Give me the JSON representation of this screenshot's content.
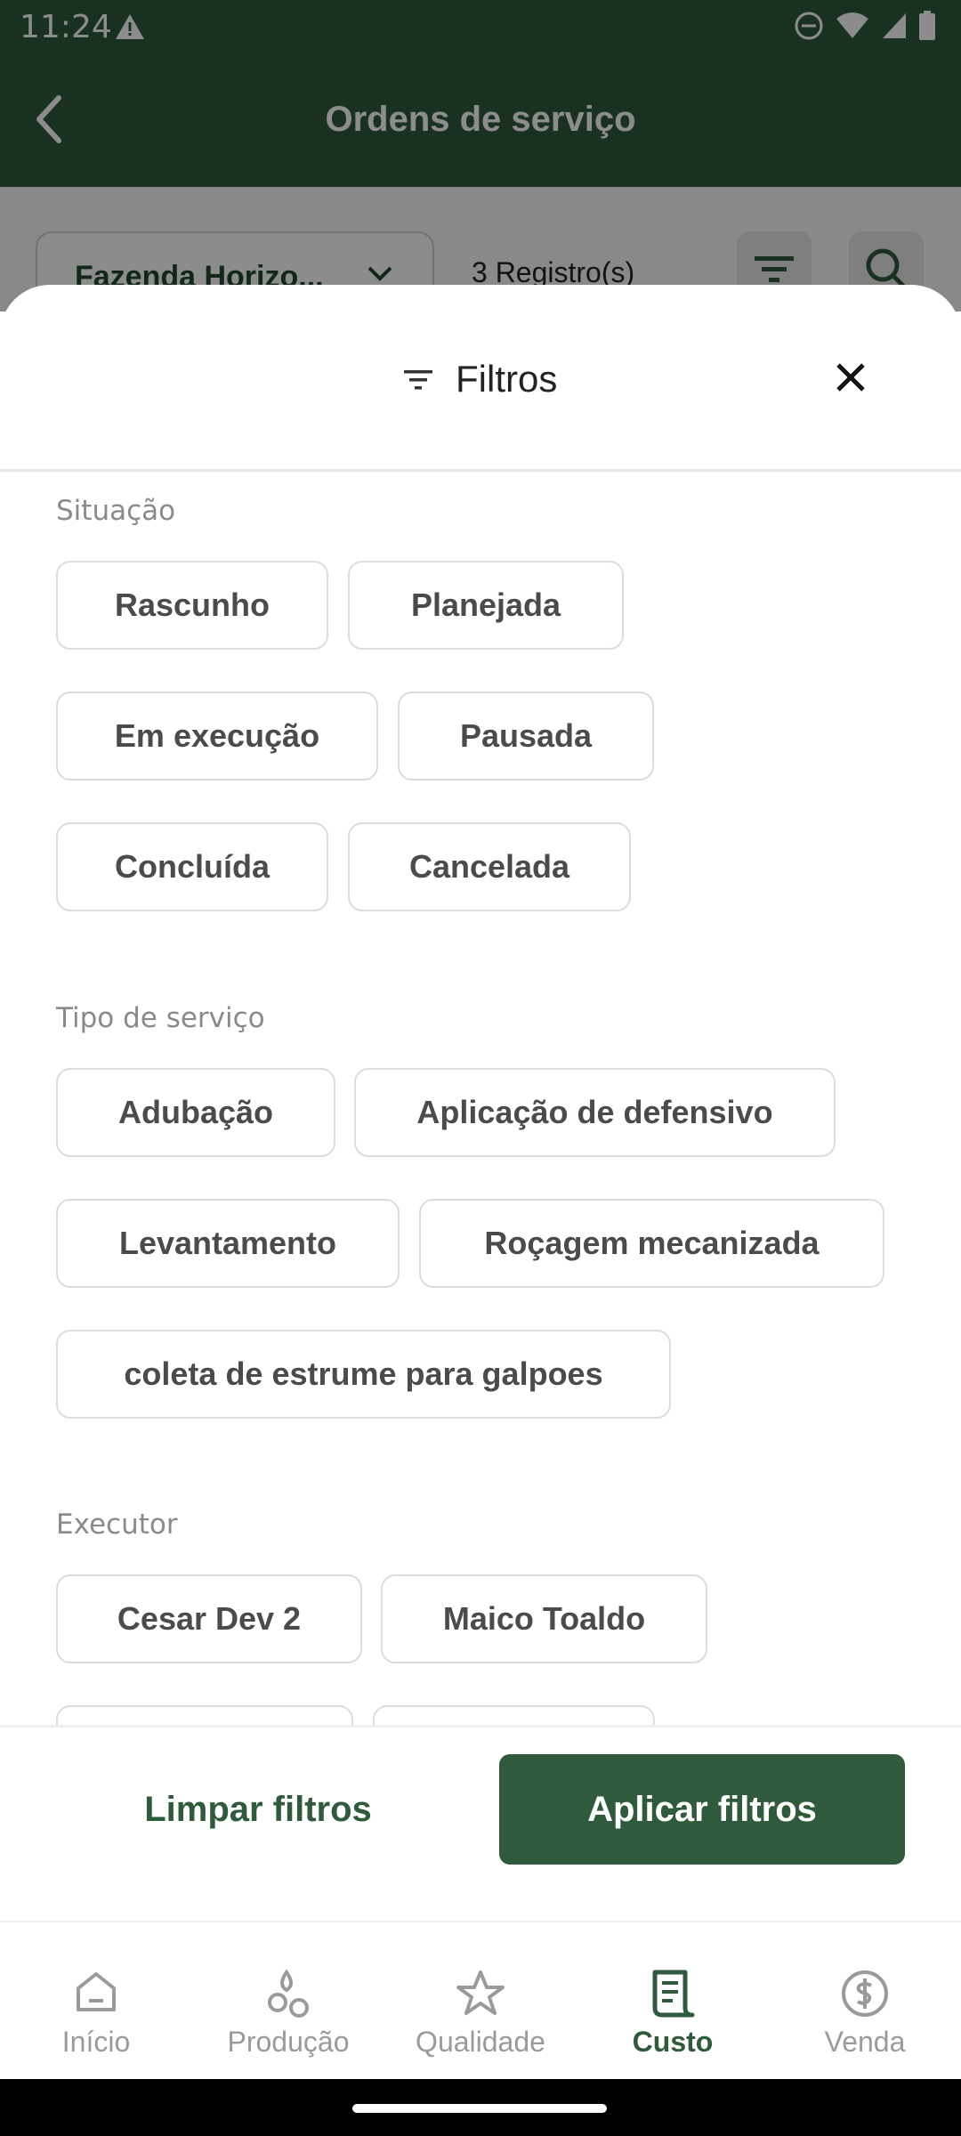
{
  "status_bar": {
    "time": "11:24"
  },
  "header": {
    "title": "Ordens de serviço"
  },
  "background": {
    "farm_label": "Fazenda Horizo...",
    "records": "3 Registro(s)"
  },
  "sheet": {
    "title": "Filtros",
    "sections": {
      "situacao": {
        "title": "Situação",
        "chips": [
          "Rascunho",
          "Planejada",
          "Em execução",
          "Pausada",
          "Concluída",
          "Cancelada"
        ]
      },
      "tipo": {
        "title": "Tipo de serviço",
        "chips": [
          "Adubação",
          "Aplicação de defensivo",
          "Levantamento",
          "Roçagem mecanizada",
          "coleta de estrume para galpoes"
        ]
      },
      "executor": {
        "title": "Executor",
        "chips": [
          "Cesar Dev 2",
          "Maico Toaldo"
        ]
      }
    },
    "clear_label": "Limpar filtros",
    "apply_label": "Aplicar filtros"
  },
  "bottom_nav": {
    "items": [
      {
        "label": "Início",
        "icon": "home-icon"
      },
      {
        "label": "Produção",
        "icon": "drops-icon"
      },
      {
        "label": "Qualidade",
        "icon": "star-icon"
      },
      {
        "label": "Custo",
        "icon": "receipt-icon",
        "active": true
      },
      {
        "label": "Venda",
        "icon": "dollar-icon"
      }
    ]
  },
  "colors": {
    "primary": "#2f5a3b",
    "chip_border": "#dcdcdc",
    "muted": "#8a8a8a"
  }
}
